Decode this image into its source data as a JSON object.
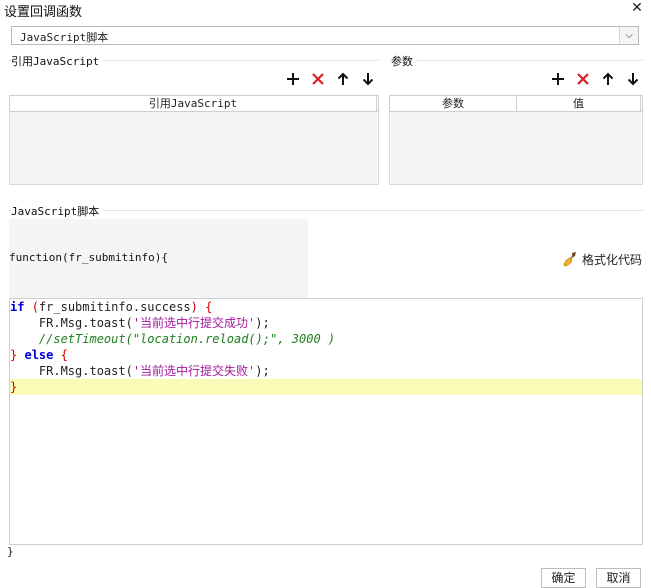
{
  "window": {
    "title": "设置回调函数"
  },
  "type_select": {
    "value": "JavaScript脚本"
  },
  "ref_section": {
    "label": "引用JavaScript",
    "columns": [
      "引用JavaScript"
    ]
  },
  "params_section": {
    "label": "参数",
    "columns": [
      "参数",
      "值"
    ]
  },
  "script_section": {
    "label": "JavaScript脚本",
    "func_head": "function(fr_submitinfo){",
    "format_label": "格式化代码",
    "func_tail": "}"
  },
  "code": {
    "l1_kw_if": "if",
    "l1_open": "(",
    "l1_var": "fr_submitinfo.success",
    "l1_close": ")",
    "l1_brace": "{",
    "l2_call": "FR.Msg.toast(",
    "l2_str": "'当前选中行提交成功'",
    "l2_end": ");",
    "l3_comment": "//setTimeout(\"location.reload();\", 3000 )",
    "l4_brace_close": "}",
    "l4_else": "else",
    "l4_brace_open": "{",
    "l5_call": "FR.Msg.toast(",
    "l5_str": "'当前选中行提交失败'",
    "l5_end": ");",
    "l6_brace": "}"
  },
  "icons": {
    "add": "plus-icon",
    "delete": "delete-x-icon",
    "up": "arrow-up-icon",
    "down": "arrow-down-icon",
    "format": "broom-icon",
    "close": "close-icon",
    "dropdown": "chevron-down-icon"
  },
  "colors": {
    "delete_red": "#e02020",
    "highlight_line": "#fbfbb8"
  },
  "footer": {
    "ok": "确定",
    "cancel": "取消"
  }
}
